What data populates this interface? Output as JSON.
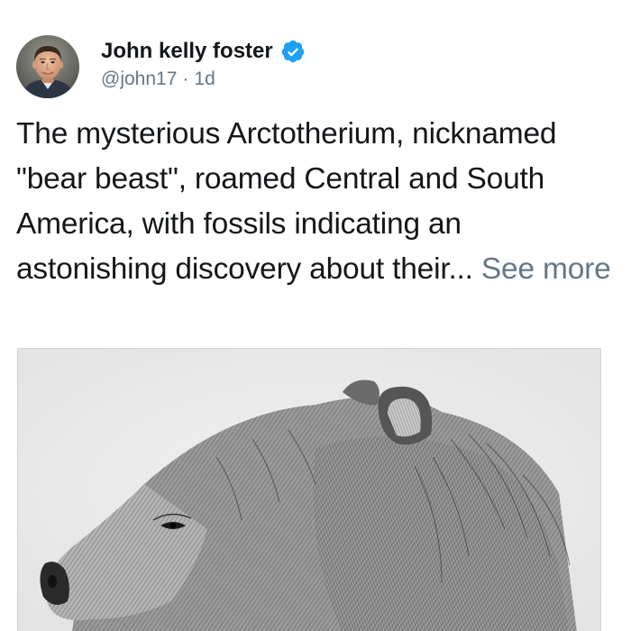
{
  "tweet": {
    "author_name": "John kelly foster",
    "handle": "@john17",
    "separator": "·",
    "time_ago": "1d",
    "text": "The mysterious Arctotherium, nicknamed \"bear beast\", roamed Central and South America, with fossils indicating an astonishing discovery about their... ",
    "see_more": "See more",
    "avatar_icon": "profile-photo",
    "verified_icon": "verified-badge-icon",
    "media_icon": "bear-sketch-image"
  },
  "colors": {
    "text": "#14171a",
    "secondary_text": "#657786",
    "verified_blue": "#1da1f2",
    "media_border": "#cfd5da",
    "background": "#ffffff"
  }
}
